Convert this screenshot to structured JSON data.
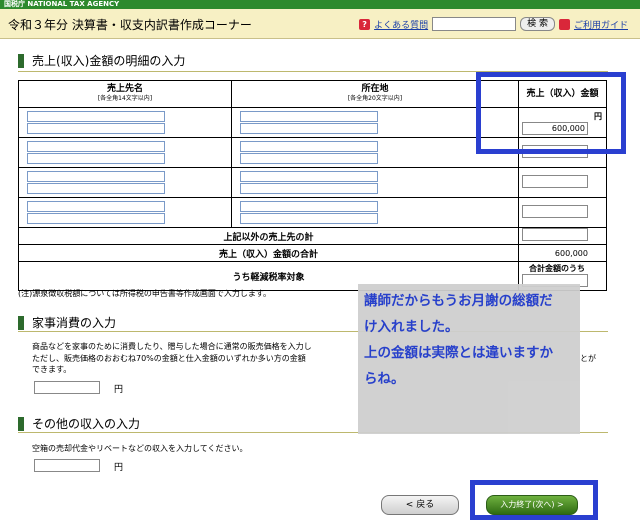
{
  "topbar": {
    "agency": "国税庁 NATIONAL TAX AGENCY"
  },
  "header": {
    "title": "令和３年分 決算書・収支内訳書作成コーナー",
    "faq_label": "よくある質問",
    "search_placeholder": "",
    "search_button": "検 索",
    "guide_label": "ご利用ガイド"
  },
  "sales_section": {
    "title": "売上(収入)金額の明細の入力",
    "col_name": "売上先名",
    "col_name_note": "[各全角14文字以内]",
    "col_address": "所在地",
    "col_address_note": "[各全角20文字以内]",
    "col_amount": "売上（収入）金額",
    "unit_yen": "円",
    "rows": [
      {
        "amount": "600,000"
      },
      {
        "amount": ""
      },
      {
        "amount": ""
      },
      {
        "amount": ""
      }
    ],
    "other_total_label": "上記以外の売上先の計",
    "total_label": "売上（収入）金額の合計",
    "total_value": "600,000",
    "reduced_tax_label": "うち軽減税率対象",
    "reduced_sub_label": "合計金額のうち"
  },
  "note": "(注)源泉徴収税額については所得税の申告書等作成画面で入力します。",
  "household_section": {
    "title": "家事消費の入力",
    "line1": "商品などを家事のために消費したり、贈与した場合に通常の販売価格を入力し",
    "line1_tail": "とが",
    "line2": "ただし、販売価格のおおむね70%の金額と仕入金額のいずれか多い方の金額",
    "line3": "できます。",
    "unit": "円"
  },
  "other_section": {
    "title": "その他の収入の入力",
    "desc": "空箱の売却代金やリベートなどの収入を入力してください。",
    "unit": "円"
  },
  "overlay": {
    "lines": [
      "講師だからもうお月謝の総額だ",
      "け入れました。",
      "上の金額は実際とは違いますか",
      "らね。"
    ]
  },
  "buttons": {
    "back": "< 戻る",
    "next": "入力終了(次へ) >"
  },
  "colors": {
    "accent_green": "#2d8a2d",
    "highlight_blue": "#2a3fd0",
    "header_bg": "#f7f0c4"
  }
}
